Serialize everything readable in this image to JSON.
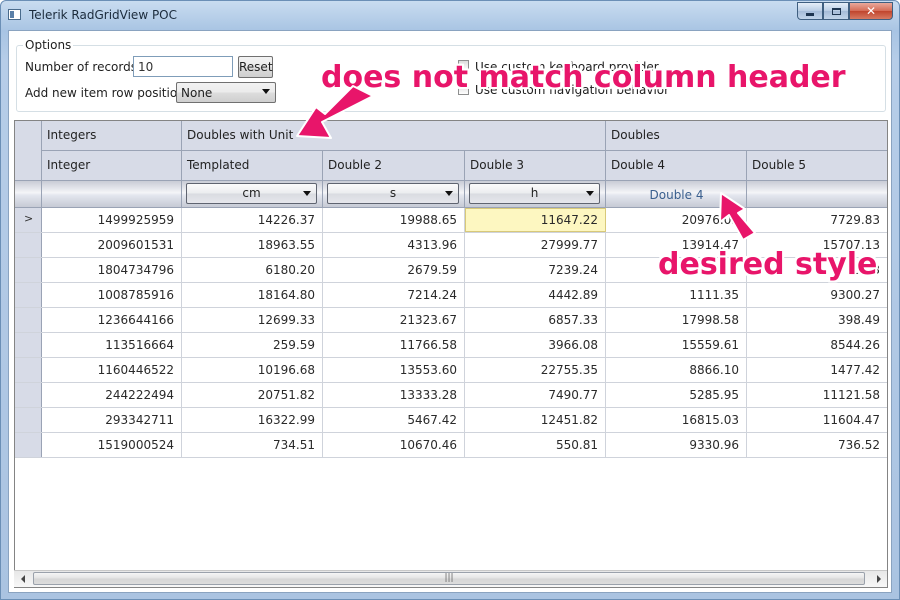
{
  "window": {
    "title": "Telerik RadGridView POC",
    "close_glyph": "✕"
  },
  "options": {
    "legend": "Options",
    "records_label": "Number of records:",
    "records_value": "10",
    "reset_label": "Reset",
    "row_position_label": "Add new item row position:",
    "row_position_value": "None",
    "custom_keyboard_label": "Use custom keyboard provider",
    "custom_navigation_label": "Use custom navigation behavior"
  },
  "grid": {
    "group_headers": [
      "Integers",
      "Doubles with Unit",
      "Doubles"
    ],
    "column_headers": [
      "Integer",
      "Templated",
      "Double 2",
      "Double 3",
      "Double 4",
      "Double 5"
    ],
    "filter_row": {
      "units": [
        "cm",
        "s",
        "h"
      ],
      "desired_style_text": "Double 4"
    },
    "current_row_glyph": ">",
    "rows": [
      [
        "1499925959",
        "14226.37",
        "19988.65",
        "11647.22",
        "20976.03",
        "7729.83"
      ],
      [
        "2009601531",
        "18963.55",
        "4313.96",
        "27999.77",
        "13914.47",
        "15707.13"
      ],
      [
        "1804734796",
        "6180.20",
        "2679.59",
        "7239.24",
        "",
        "3.93"
      ],
      [
        "1008785916",
        "18164.80",
        "7214.24",
        "4442.89",
        "1111.35",
        "9300.27"
      ],
      [
        "1236644166",
        "12699.33",
        "21323.67",
        "6857.33",
        "17998.58",
        "398.49"
      ],
      [
        "113516664",
        "259.59",
        "11766.58",
        "3966.08",
        "15559.61",
        "8544.26"
      ],
      [
        "1160446522",
        "10196.68",
        "13553.60",
        "22755.35",
        "8866.10",
        "1477.42"
      ],
      [
        "244222494",
        "20751.82",
        "13333.28",
        "7490.77",
        "5285.95",
        "11121.58"
      ],
      [
        "293342711",
        "16322.99",
        "5467.42",
        "12451.82",
        "16815.03",
        "11604.47"
      ],
      [
        "1519000524",
        "734.51",
        "10670.46",
        "550.81",
        "9330.96",
        "736.52"
      ]
    ],
    "scroll_thumb_grip": "|||"
  },
  "annotations": {
    "header_mismatch": "does not match column header",
    "desired_style": "desired style",
    "color": "#e8156a"
  }
}
